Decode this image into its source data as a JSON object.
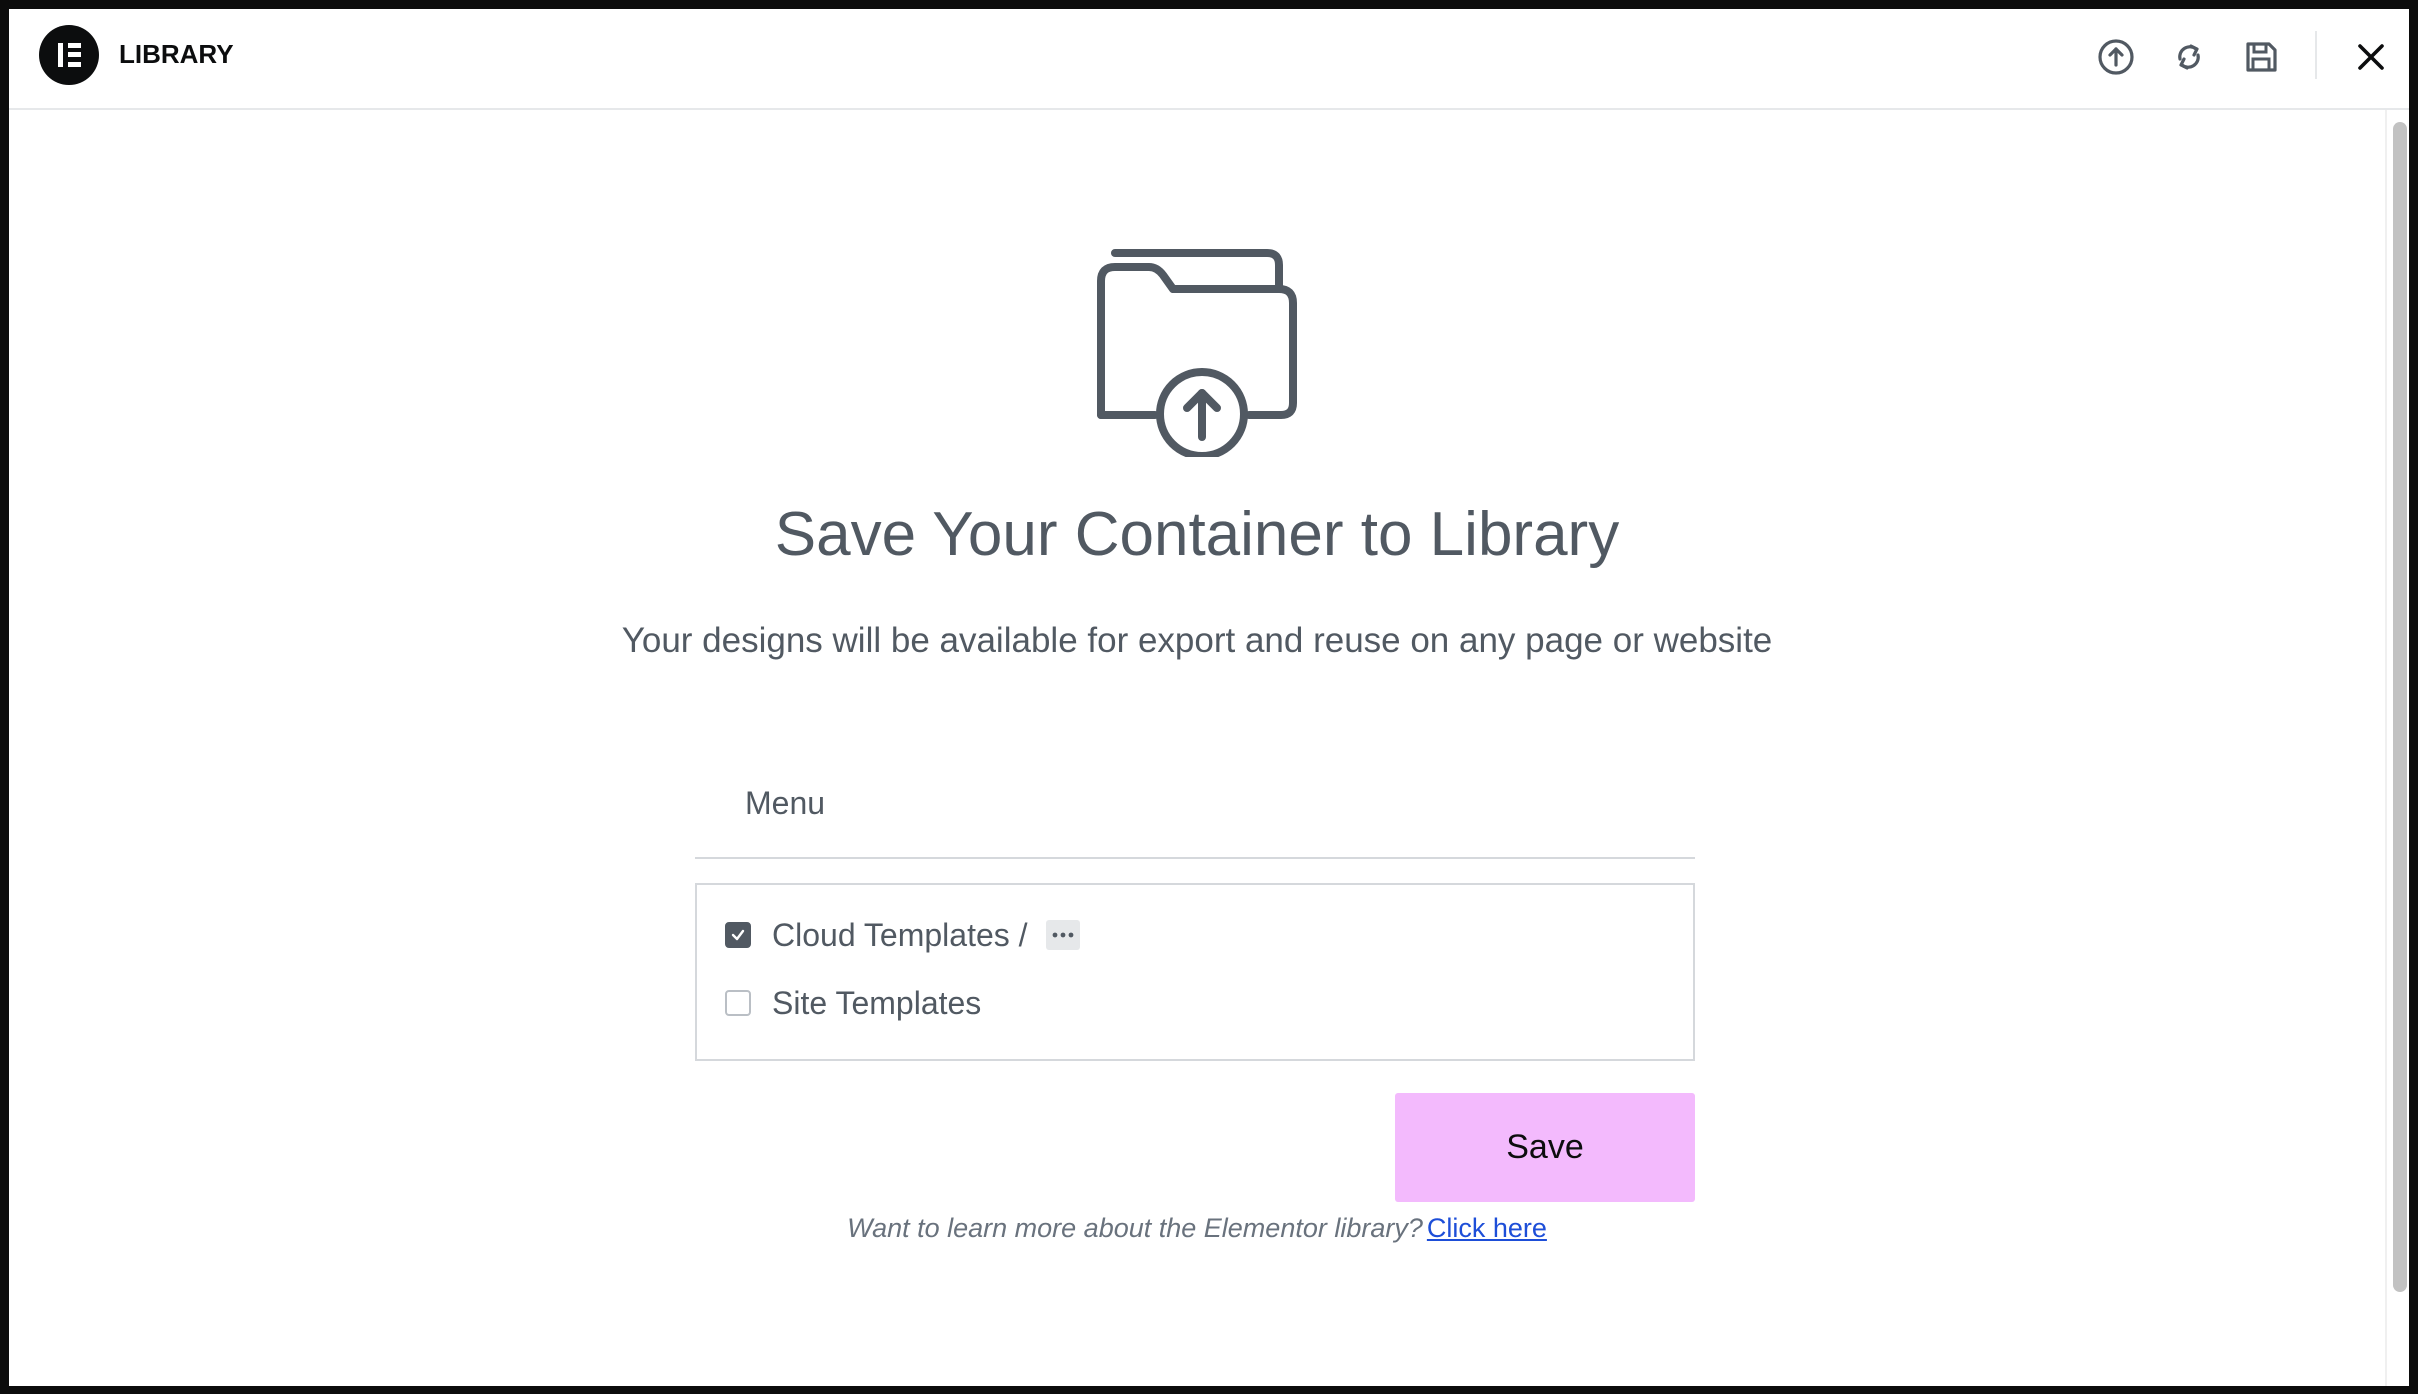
{
  "header": {
    "title": "LIBRARY",
    "icons": [
      "upload-icon",
      "sync-icon",
      "save-icon",
      "close-icon"
    ]
  },
  "main": {
    "icon": "folder-upload-icon",
    "heading": "Save Your Container to Library",
    "subheading": "Your designs will be available for export and reuse on any page or website",
    "name_input": {
      "value": "Menu"
    },
    "locations": [
      {
        "label": "Cloud Templates /",
        "checked": true,
        "has_more": true,
        "more_label": "···"
      },
      {
        "label": "Site Templates",
        "checked": false
      }
    ],
    "save_label": "Save",
    "footer": {
      "question": "Want to learn more about the Elementor library?",
      "link_text": "Click here"
    }
  },
  "colors": {
    "save_button_bg": "#f3bafd",
    "text": "#515962",
    "link": "#1d4ed8"
  }
}
